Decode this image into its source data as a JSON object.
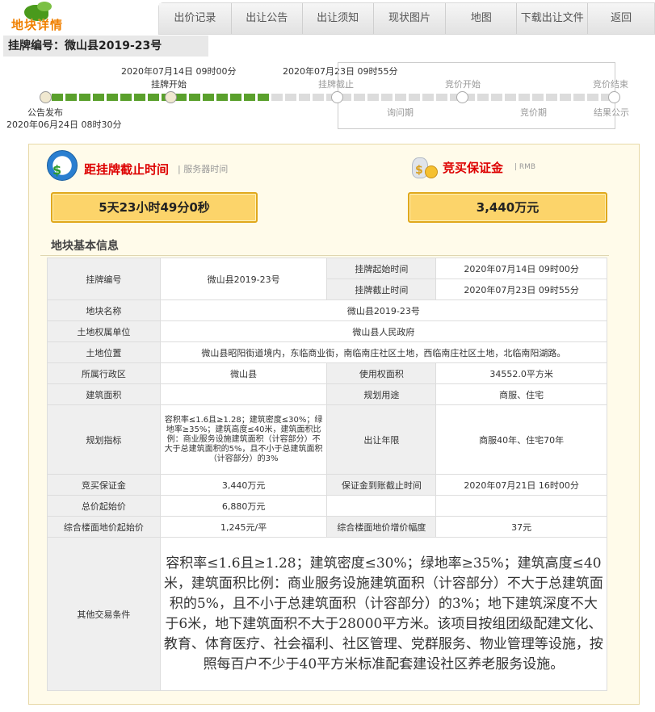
{
  "header": {
    "logo_text": "地块详情",
    "nav": [
      "出价记录",
      "出让公告",
      "出让须知",
      "现状图片",
      "地图",
      "下载出让文件",
      "返回"
    ]
  },
  "listing_bar": {
    "label": "挂牌编号：微山县2019-23号"
  },
  "timeline": {
    "publish": {
      "label": "公告发布",
      "time": "2020年06月24日 08时30分"
    },
    "listing_start": {
      "label": "挂牌开始",
      "time": "2020年07月14日 09时00分"
    },
    "listing_end": {
      "label": "挂牌截止",
      "time": "2020年07月23日 09时55分"
    },
    "inquiry": "询问期",
    "bid_start": "竞价开始",
    "bid_period": "竞价期",
    "bid_end": "竞价结束",
    "result": "结果公示"
  },
  "countdown": {
    "title": "距挂牌截止时间",
    "sub": "服务器时间",
    "value": "5天23小时49分0秒"
  },
  "deposit": {
    "title": "竞买保证金",
    "sub": "RMB",
    "value": "3,440万元"
  },
  "section_title": "地块基本信息",
  "table": {
    "listing_no_label": "挂牌编号",
    "listing_no": "微山县2019-23号",
    "start_label": "挂牌起始时间",
    "start": "2020年07月14日 09时00分",
    "end_label": "挂牌截止时间",
    "end": "2020年07月23日 09时55分",
    "name_label": "地块名称",
    "name": "微山县2019-23号",
    "owner_label": "土地权属单位",
    "owner": "微山县人民政府",
    "location_label": "土地位置",
    "location": "微山县昭阳街道境内，东临商业街，南临南庄社区土地，西临南庄社区土地，北临南阳湖路。",
    "district_label": "所属行政区",
    "district": "微山县",
    "area_label": "使用权面积",
    "area": "34552.0平方米",
    "build_area_label": "建筑面积",
    "build_area": "",
    "usage_label": "规划用途",
    "usage": "商服、住宅",
    "plan_label": "规划指标",
    "plan": "容积率≤1.6且≥1.28；建筑密度≤30%；绿地率≥35%；建筑高度≤40米，建筑面积比例：商业服务设施建筑面积（计容部分）不大于总建筑面积的5%，且不小于总建筑面积（计容部分）的3%",
    "years_label": "出让年限",
    "years": "商服40年、住宅70年",
    "deposit_label": "竞买保证金",
    "deposit": "3,440万元",
    "deadline_label": "保证金到账截止时间",
    "deadline": "2020年07月21日 16时00分",
    "total_label": "总价起始价",
    "total": "6,880万元",
    "floor_label": "综合楼面地价起始价",
    "floor": "1,245元/平",
    "inc_label": "综合楼面地价增价幅度",
    "inc": "37元",
    "other_label": "其他交易条件",
    "other": "容积率≤1.6且≥1.28；建筑密度≤30%；绿地率≥35%；建筑高度≤40米，建筑面积比例：商业服务设施建筑面积（计容部分）不大于总建筑面积的5%，且不小于总建筑面积（计容部分）的3%；地下建筑深度不大于6米，地下建筑面积不大于28000平方米。该项目按组团级配建文化、教育、体育医疗、社会福利、社区管理、党群服务、物业管理等设施，按照每百户不少于40平方米标准配套建设社区养老服务设施。"
  },
  "colors": {
    "accent_orange": "#f08000",
    "done_green": "#5aa02c",
    "box_yellow": "#fcd46a",
    "title_red": "#dd0000"
  }
}
